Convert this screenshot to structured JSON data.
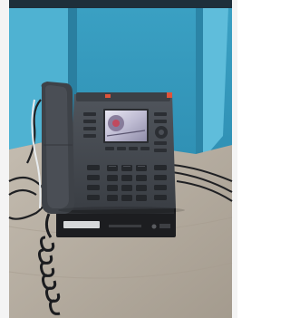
{
  "image": {
    "subject": "desk-phone-on-mini-pc",
    "colors": {
      "wall_blue": "#3fa6c8",
      "wall_blue_dark": "#2a7f9f",
      "panel_light": "#7cc6df",
      "desk_wood": "#b9b0a3",
      "desk_wood_dark": "#8d8478",
      "phone_body": "#4a4e55",
      "phone_dark": "#2f3237",
      "screen_glow": "#d8d5e8",
      "led_red": "#e0533a",
      "cable": "#2a2b2e"
    }
  }
}
